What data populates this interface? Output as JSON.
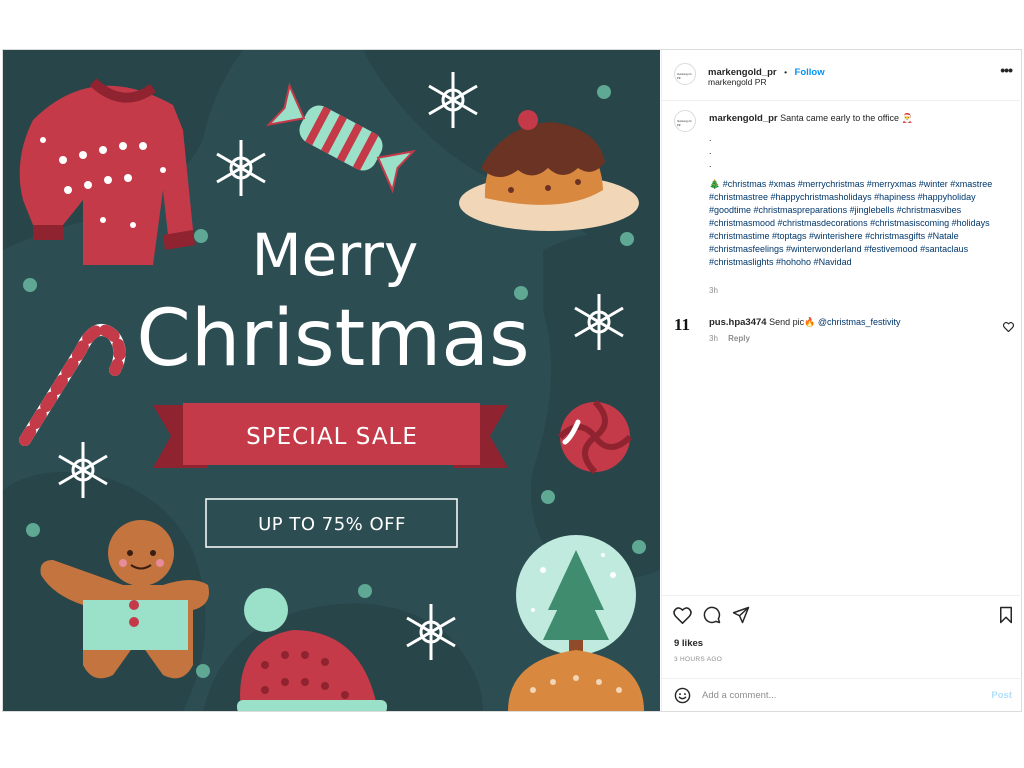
{
  "post": {
    "author": {
      "username": "markengold_pr",
      "separator": "•",
      "follow_label": "Follow",
      "display_name": "markengold PR",
      "avatar_text": "markengold PR"
    },
    "more_label": "•••",
    "caption": {
      "username": "markengold_pr",
      "text": "Santa came early to the office 🎅",
      "dots": [
        ".",
        ".",
        "."
      ],
      "tree_emoji": "🎄",
      "hashtags": "#christmas #xmas #merrychristmas #merryxmas #winter #xmastree #christmastree #happychristmasholidays #hapiness #happyholiday #goodtime #christmaspreparations #jinglebells #christmasvibes #christmasmood #christmasdecorations #christmasiscoming #holidays #christmastime #toptags #winterishere #christmasgifts #Natale #christmasfeelings #winterwonderland #festivemood #santaclaus #christmaslights #hohoho #Navidad",
      "time": "3h"
    },
    "comments": [
      {
        "avatar_text": "11",
        "username": "pus.hpa3474",
        "text": "Send pic🔥",
        "mention": "@christmas_festivity",
        "time": "3h",
        "reply_label": "Reply"
      }
    ],
    "likes": "9 likes",
    "timestamp": "3 HOURS AGO",
    "add_comment_placeholder": "Add a comment...",
    "post_button": "Post"
  },
  "image": {
    "line1": "Merry",
    "line2": "Christmas",
    "ribbon": "SPECIAL SALE",
    "offer": "UP TO 75% OFF"
  },
  "colors": {
    "background": "#2c4e53",
    "red": "#c43a48",
    "mint": "#9be0c8",
    "link": "#0095f6"
  }
}
